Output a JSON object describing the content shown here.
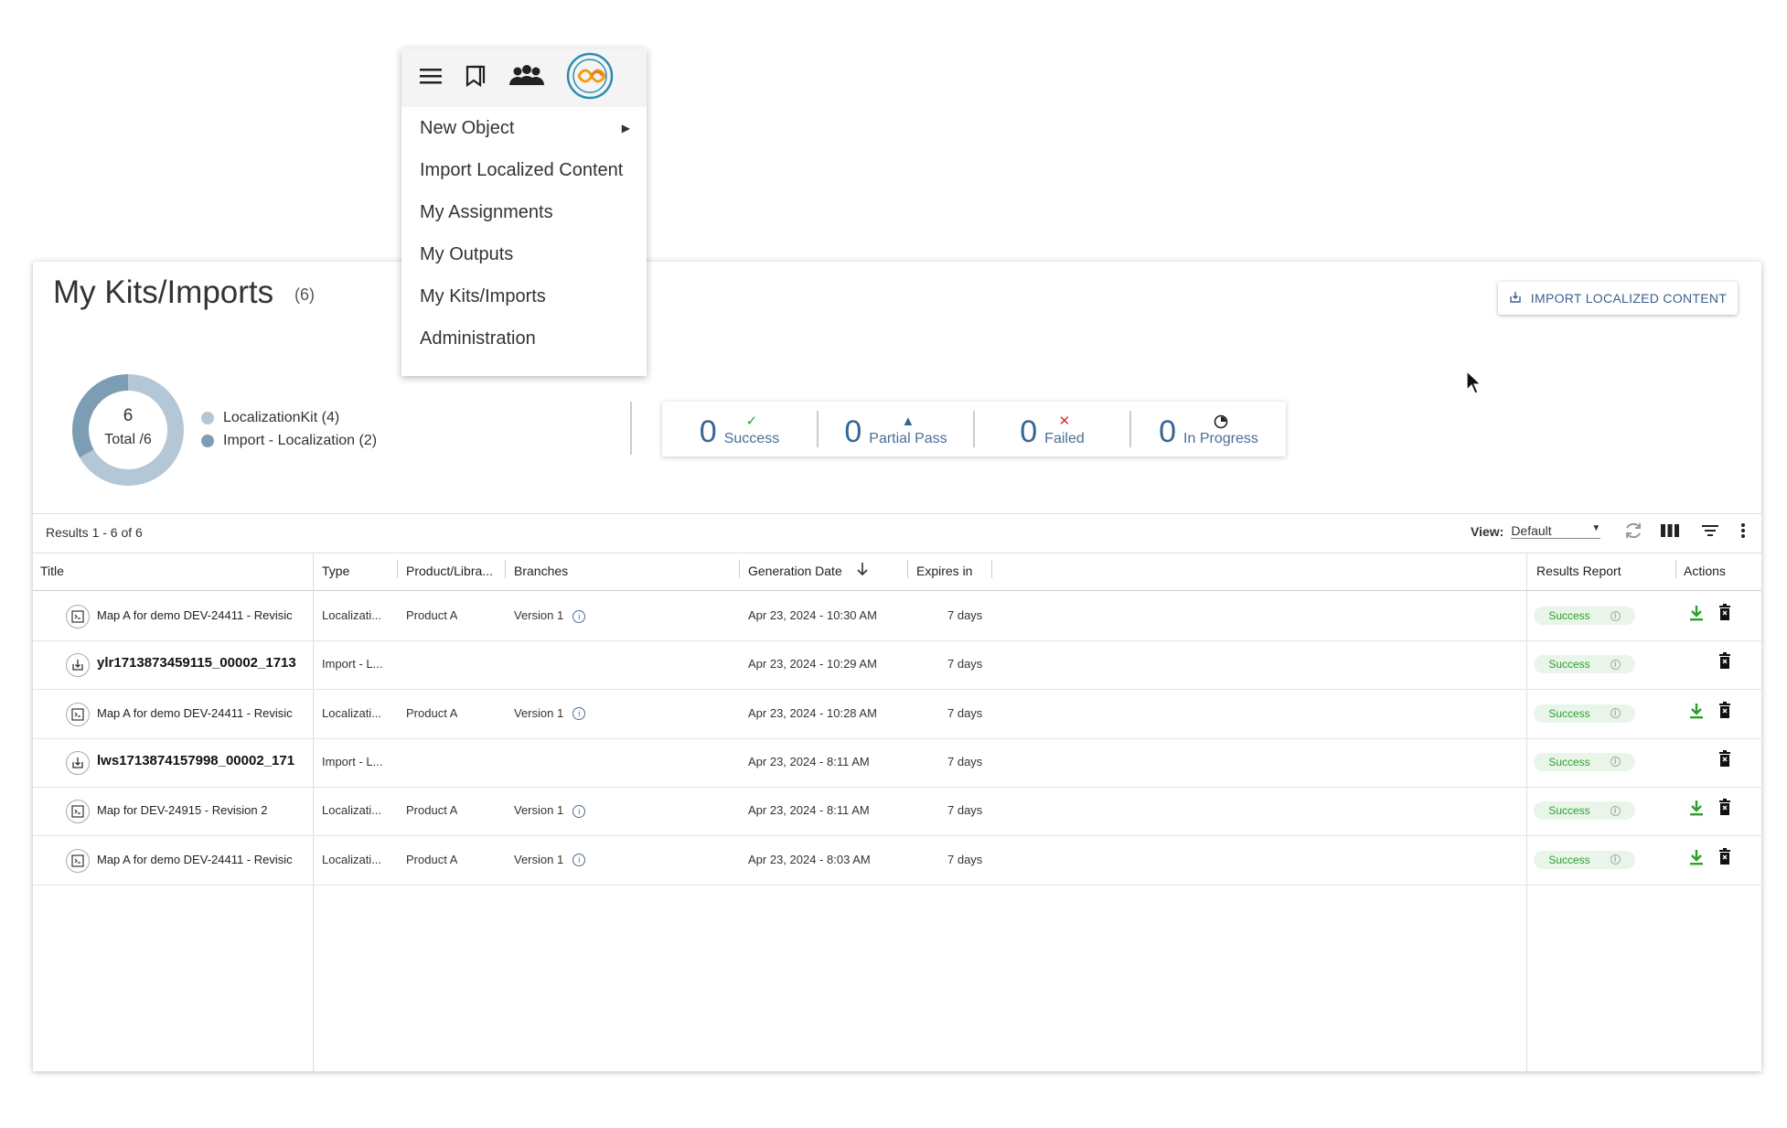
{
  "menu": {
    "items": [
      {
        "label": "New Object",
        "has_submenu": true
      },
      {
        "label": "Import Localized Content"
      },
      {
        "label": "My Assignments"
      },
      {
        "label": "My Outputs"
      },
      {
        "label": "My Kits/Imports"
      },
      {
        "label": "Administration"
      }
    ],
    "icons": [
      "hamburger-icon",
      "bookmarks-icon",
      "people-icon",
      "app-logo-icon"
    ]
  },
  "header": {
    "title": "My Kits/Imports",
    "count": "(6)",
    "import_button": "IMPORT LOCALIZED CONTENT"
  },
  "summary": {
    "donut_number": "6",
    "donut_total": "Total /6",
    "legend": [
      {
        "label": "LocalizationKit (4)",
        "value": 4,
        "color": "#b4c7d6"
      },
      {
        "label": "Import - Localization (2)",
        "value": 2,
        "color": "#7d9db5"
      }
    ],
    "stats": [
      {
        "number": "0",
        "label": "Success",
        "icon": "check-icon",
        "color": "#2ca02c"
      },
      {
        "number": "0",
        "label": "Partial Pass",
        "icon": "warning-triangle-icon",
        "color": "#3a6591"
      },
      {
        "number": "0",
        "label": "Failed",
        "icon": "x-icon",
        "color": "#d32f2f"
      },
      {
        "number": "0",
        "label": "In Progress",
        "icon": "progress-icon",
        "color": "#333333"
      }
    ]
  },
  "toolbar": {
    "results": "Results 1 - 6 of 6",
    "view_label": "View:",
    "view_value": "Default"
  },
  "table": {
    "headers": {
      "title": "Title",
      "type": "Type",
      "product": "Product/Libra...",
      "branches": "Branches",
      "generation_date": "Generation Date",
      "expires": "Expires in",
      "results_report": "Results Report",
      "actions": "Actions"
    },
    "rows": [
      {
        "title": "Map A for demo DEV-24411 - Revisic",
        "type": "Localizati...",
        "product": "Product A",
        "branch": "Version 1",
        "date": "Apr 23, 2024 - 10:30 AM",
        "expires": "7 days",
        "status": "Success",
        "kind": "kit",
        "bold": false
      },
      {
        "title": "ylr1713873459115_00002_1713",
        "type": "Import - L...",
        "product": "",
        "branch": "",
        "date": "Apr 23, 2024 - 10:29 AM",
        "expires": "7 days",
        "status": "Success",
        "kind": "import",
        "bold": true
      },
      {
        "title": "Map A for demo DEV-24411 - Revisic",
        "type": "Localizati...",
        "product": "Product A",
        "branch": "Version 1",
        "date": "Apr 23, 2024 - 10:28 AM",
        "expires": "7 days",
        "status": "Success",
        "kind": "kit",
        "bold": false
      },
      {
        "title": "lws1713874157998_00002_171",
        "type": "Import - L...",
        "product": "",
        "branch": "",
        "date": "Apr 23, 2024 - 8:11 AM",
        "expires": "7 days",
        "status": "Success",
        "kind": "import",
        "bold": true
      },
      {
        "title": "Map for DEV-24915 - Revision 2",
        "type": "Localizati...",
        "product": "Product A",
        "branch": "Version 1",
        "date": "Apr 23, 2024 - 8:11 AM",
        "expires": "7 days",
        "status": "Success",
        "kind": "kit",
        "bold": false
      },
      {
        "title": "Map A for demo DEV-24411 - Revisic",
        "type": "Localizati...",
        "product": "Product A",
        "branch": "Version 1",
        "date": "Apr 23, 2024 - 8:03 AM",
        "expires": "7 days",
        "status": "Success",
        "kind": "kit",
        "bold": false
      }
    ]
  }
}
